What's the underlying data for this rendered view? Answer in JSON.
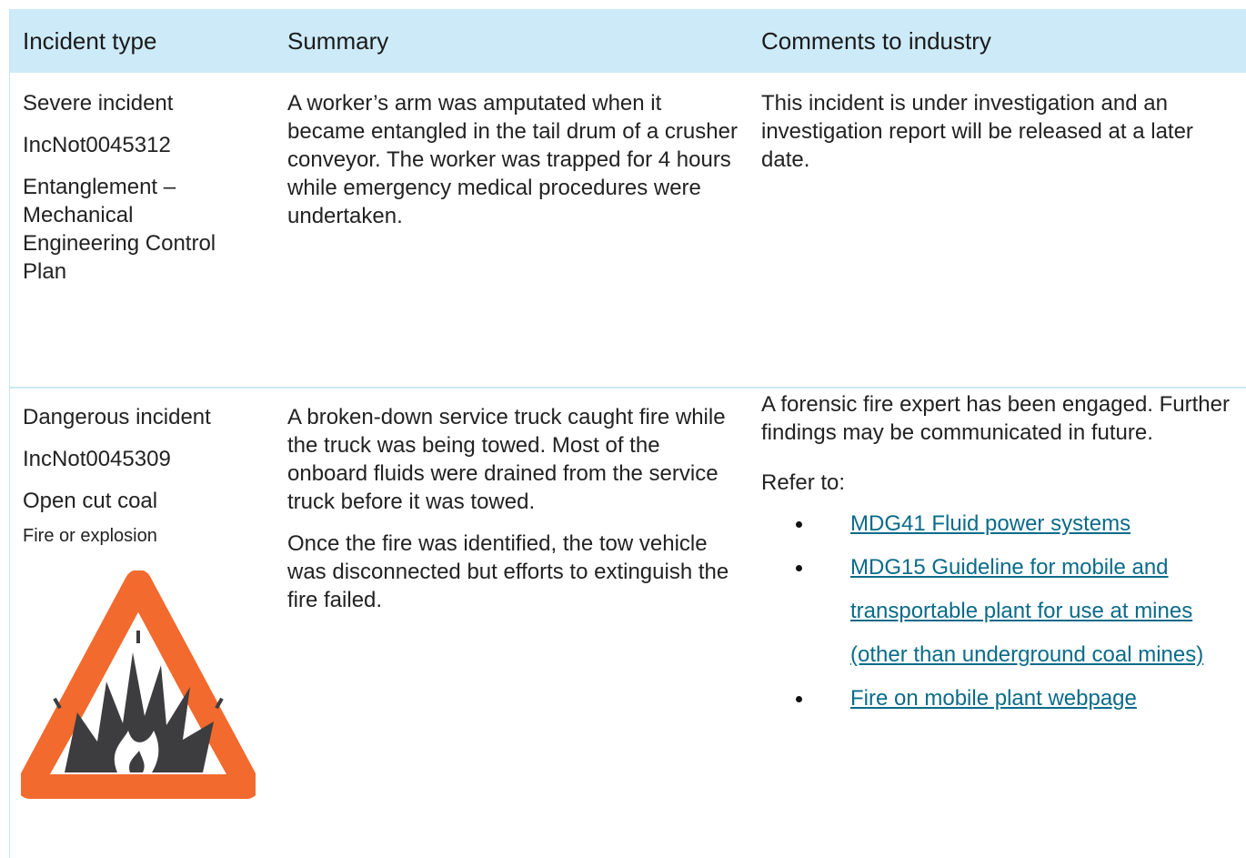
{
  "headers": [
    "Incident type",
    "Summary",
    "Comments to industry"
  ],
  "rows": [
    {
      "type": [
        "Severe incident",
        "IncNot0045312",
        "Entanglement – Mechanical Engineering Control Plan"
      ],
      "summary": [
        "A worker’s arm was amputated when it became entangled in the tail drum of a crusher conveyor. The worker was trapped for 4 hours while emergency medical procedures were undertaken."
      ],
      "comments": [
        "This incident is under investigation and an investigation report will be released at a later date."
      ]
    },
    {
      "type": [
        "Dangerous incident",
        "IncNot0045309",
        "Open cut coal",
        "Fire or explosion"
      ],
      "summary": [
        "A broken-down service truck caught fire while the truck was being towed. Most of the onboard fluids were drained from the service truck before it was towed.",
        "Once the fire was identified, the tow vehicle was disconnected but efforts to extinguish the fire failed."
      ],
      "comments": [
        "A forensic fire expert has been engaged. Further findings may be communicated in future."
      ],
      "refer_label": "Refer to:",
      "links": [
        "MDG41 Fluid power systems",
        "MDG15 Guideline for mobile and transportable plant for use at mines (other than underground coal mines)",
        "Fire on mobile plant webpage"
      ],
      "icon": "fire-explosion-warning-icon"
    }
  ],
  "colors": {
    "header_bg": "#cdeaf8",
    "link": "#0b6b8a",
    "warning_orange": "#f26a2e",
    "warning_dark": "#3d3d3f"
  }
}
